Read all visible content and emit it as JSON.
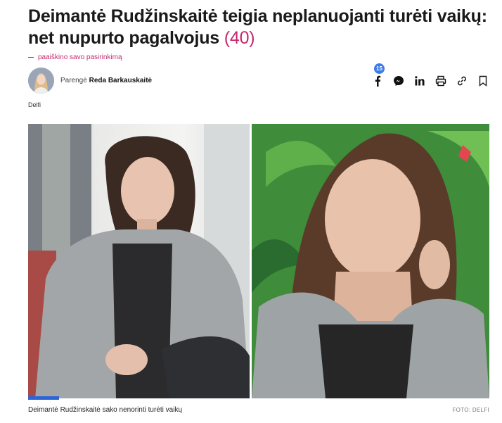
{
  "article": {
    "headline": "Deimantė Rudžinskaitė teigia neplanuojanti turėti vaikų: net nupurto pagalvojus",
    "comment_count": "(40)",
    "subtitle": "paaiškino savo pasirinkimą",
    "prepared_label": "Parengė",
    "author_name": "Reda Barkauskaitė",
    "source": "Delfi"
  },
  "share": {
    "facebook_count": "15",
    "icons": [
      "facebook-icon",
      "messenger-icon",
      "linkedin-icon",
      "print-icon",
      "link-icon",
      "bookmark-icon"
    ]
  },
  "photo": {
    "caption": "Deimantė Rudžinskaitė sako nenorinti turėti vaikų",
    "credit": "FOTO: DELFI"
  },
  "colors": {
    "accent": "#c8286f",
    "badge": "#3d7be8",
    "progress": "#2e64d6"
  }
}
